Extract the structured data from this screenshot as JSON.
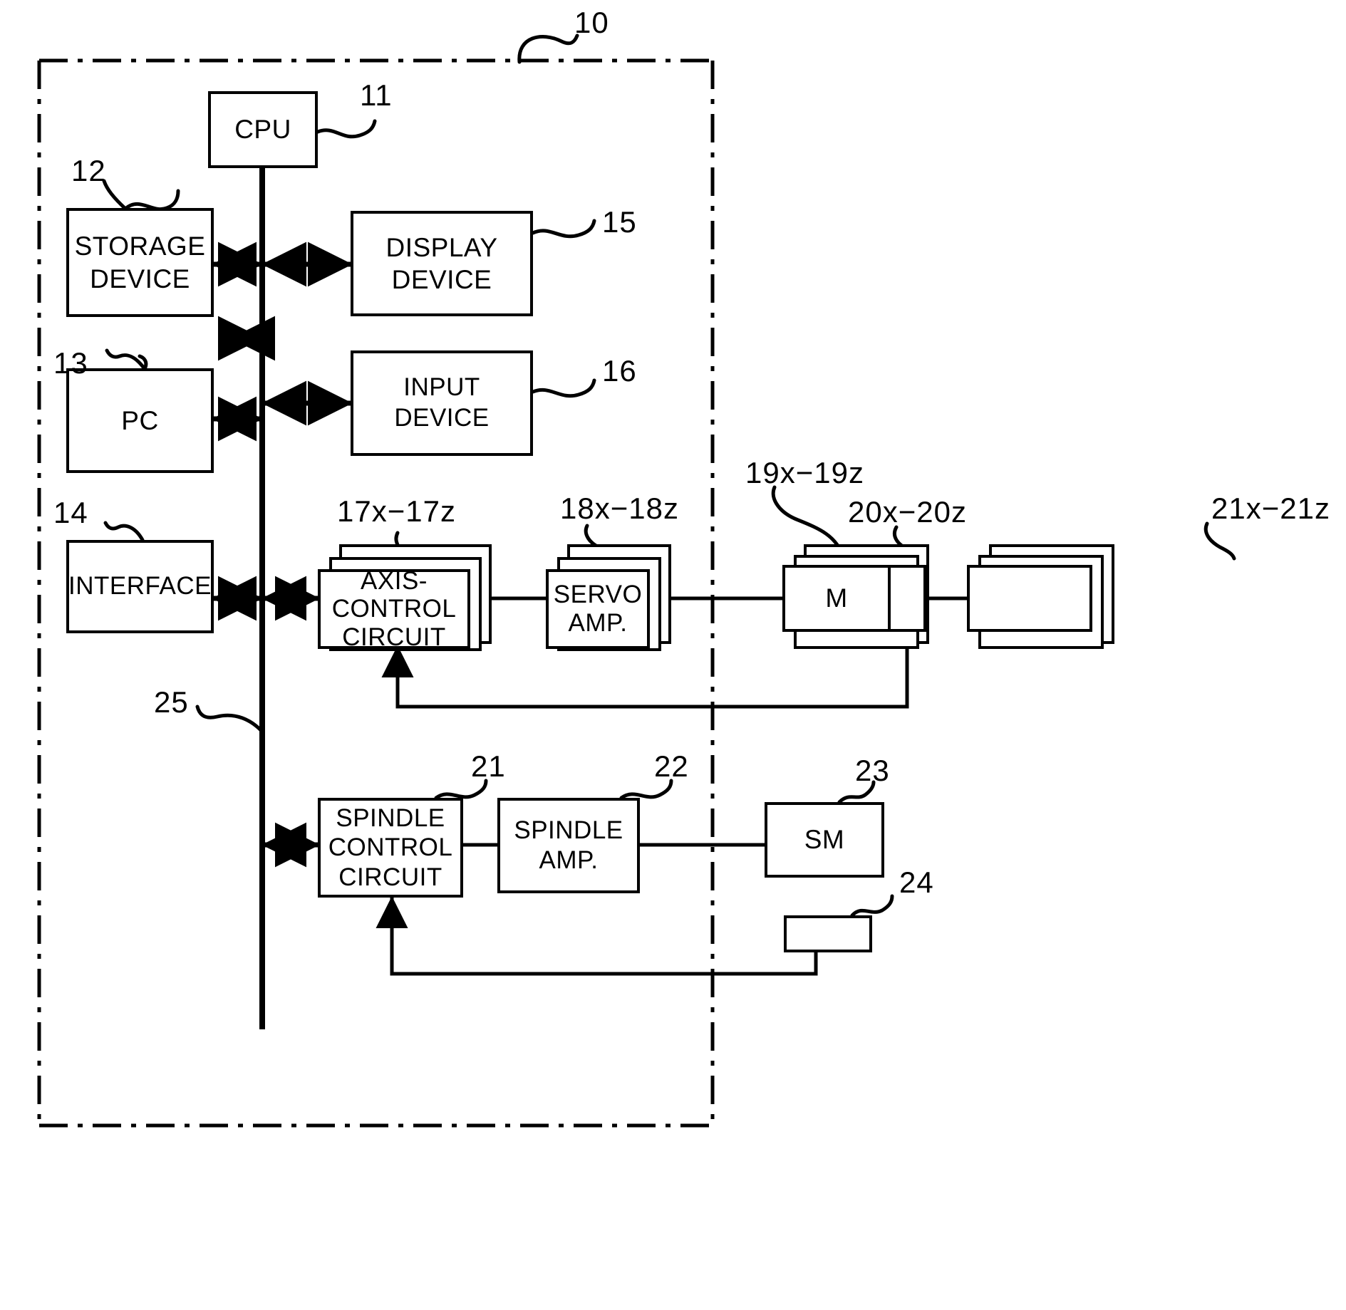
{
  "figure": {
    "type": "patent-block-diagram",
    "description": "CNC numerical controller block diagram"
  },
  "boundary": {
    "ref": "10",
    "style": "dash-dot"
  },
  "bus": {
    "ref": "25",
    "name": "bus"
  },
  "blocks": [
    {
      "id": "cpu",
      "label": "CPU",
      "ref": "11"
    },
    {
      "id": "storage-device",
      "label": "STORAGE\nDEVICE",
      "ref": "12"
    },
    {
      "id": "pc",
      "label": "PC",
      "ref": "13"
    },
    {
      "id": "interface",
      "label": "INTERFACE",
      "ref": "14"
    },
    {
      "id": "display-device",
      "label": "DISPLAY\nDEVICE",
      "ref": "15"
    },
    {
      "id": "input-device",
      "label": "INPUT DEVICE",
      "ref": "16"
    },
    {
      "id": "axis-control-circuit",
      "label": "AXIS-\nCONTROL\nCIRCUIT",
      "ref": "17x−17z"
    },
    {
      "id": "servo-amp",
      "label": "SERVO\nAMP.",
      "ref": "18x−18z"
    },
    {
      "id": "servo-motor",
      "label": "M",
      "ref": "19x−19z"
    },
    {
      "id": "position-detector",
      "label": "",
      "ref": "20x−20z"
    },
    {
      "id": "machine-axis",
      "label": "",
      "ref": "21x−21z"
    },
    {
      "id": "spindle-control-circuit",
      "label": "SPINDLE\nCONTROL\nCIRCUIT",
      "ref": "21"
    },
    {
      "id": "spindle-amp",
      "label": "SPINDLE\nAMP.",
      "ref": "22"
    },
    {
      "id": "spindle-motor",
      "label": "SM",
      "ref": "23"
    },
    {
      "id": "spindle-detector",
      "label": "",
      "ref": "24"
    }
  ],
  "refs": {
    "r10": "10",
    "r11": "11",
    "r12": "12",
    "r13": "13",
    "r14": "14",
    "r15": "15",
    "r16": "16",
    "r17": "17x−17z",
    "r18": "18x−18z",
    "r19": "19x−19z",
    "r20": "20x−20z",
    "r21s": "21x−21z",
    "r21": "21",
    "r22": "22",
    "r23": "23",
    "r24": "24",
    "r25": "25"
  },
  "labels": {
    "cpu": "CPU",
    "storage_line1": "STORAGE",
    "storage_line2": "DEVICE",
    "pc": "PC",
    "interface": "INTERFACE",
    "display_line1": "DISPLAY",
    "display_line2": "DEVICE",
    "input_device": "INPUT DEVICE",
    "axis_line1": "AXIS-",
    "axis_line2": "CONTROL",
    "axis_line3": "CIRCUIT",
    "servo_line1": "SERVO",
    "servo_line2": "AMP.",
    "motor": "M",
    "spindle_line1": "SPINDLE",
    "spindle_line2": "CONTROL",
    "spindle_line3": "CIRCUIT",
    "spindle_amp_line1": "SPINDLE",
    "spindle_amp_line2": "AMP.",
    "spindle_motor": "SM"
  },
  "colors": {
    "stroke": "#000000",
    "background": "#ffffff"
  }
}
